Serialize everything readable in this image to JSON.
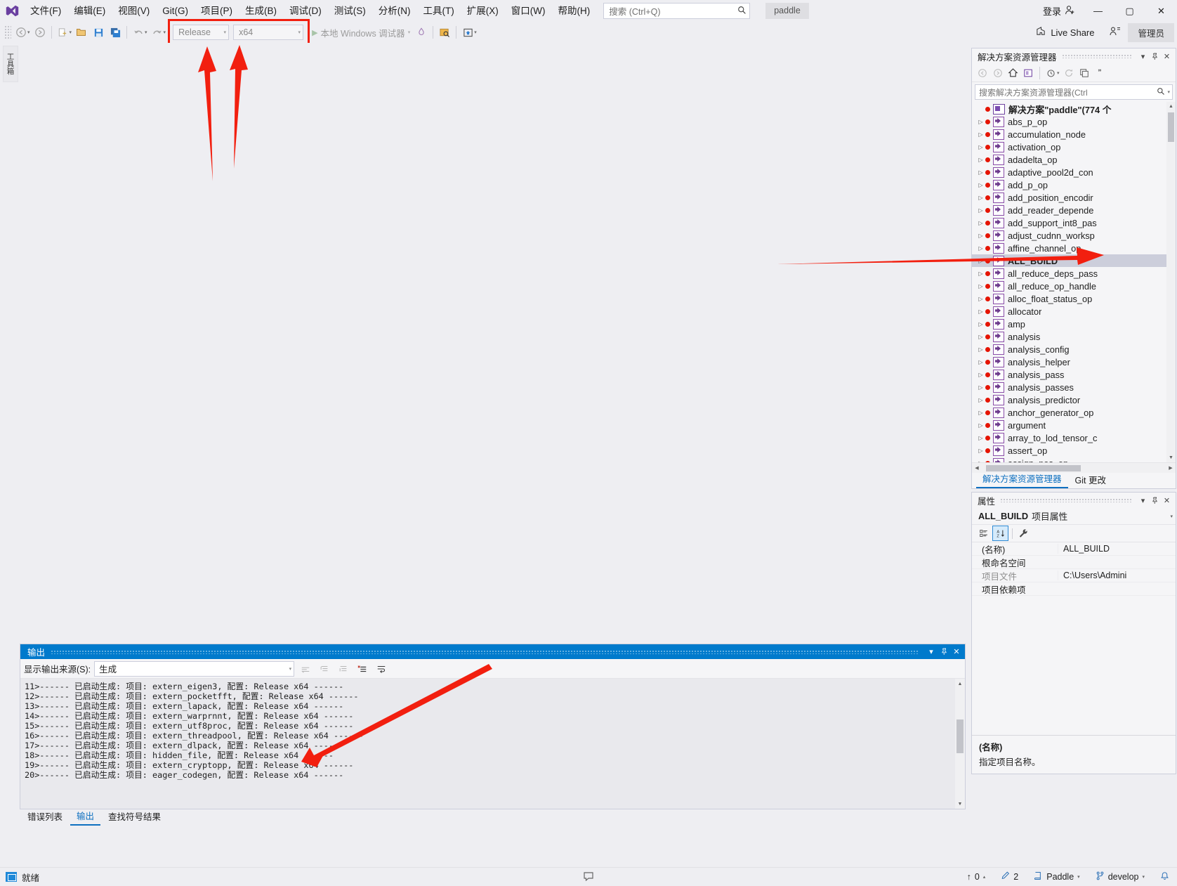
{
  "window": {
    "app_icon": "visual-studio-icon",
    "project_chip": "paddle",
    "signin_label": "登录",
    "minimize": "—",
    "maximize": "▢",
    "close": "✕",
    "live_share": "Live Share",
    "admin_badge": "管理员"
  },
  "menu": {
    "items": [
      "文件(F)",
      "编辑(E)",
      "视图(V)",
      "Git(G)",
      "项目(P)",
      "生成(B)",
      "调试(D)",
      "测试(S)",
      "分析(N)",
      "工具(T)",
      "扩展(X)",
      "窗口(W)",
      "帮助(H)"
    ]
  },
  "search": {
    "placeholder": "搜索 (Ctrl+Q)",
    "icon": "search-icon"
  },
  "toolbar": {
    "back_icon": "navigate-back-icon",
    "forward_icon": "navigate-forward-icon",
    "new_item_icon": "new-item-icon",
    "open_icon": "open-file-icon",
    "save_icon": "save-icon",
    "save_all_icon": "save-all-icon",
    "undo_icon": "undo-icon",
    "redo_icon": "redo-icon",
    "configuration": "Release",
    "platform": "x64",
    "run_label": "本地 Windows 调试器",
    "run_play_icon": "play-icon",
    "hot_reload_icon": "hot-reload-icon",
    "select_tool_icon": "select-element-icon",
    "live_visual_tree_icon": "live-visual-tree-icon"
  },
  "editor": {
    "vertical_tab_label": "工具箱"
  },
  "solution_explorer": {
    "title": "解决方案资源管理器",
    "dropdown_icon": "chevron-down-icon",
    "pin_icon": "pin-icon",
    "close_icon": "close-icon",
    "toolbar_icons": [
      "back-icon",
      "forward-icon",
      "home-icon",
      "solution-view-icon",
      "pending-changes-icon",
      "refresh-icon",
      "collapse-all-icon",
      "overflow-icon"
    ],
    "search_placeholder": "搜索解决方案资源管理器(Ctrl",
    "search_icon": "search-icon",
    "search_dropdown_icon": "chevron-down-icon",
    "root": "解决方案\"paddle\"(774 个",
    "items": [
      "abs_p_op",
      "accumulation_node",
      "activation_op",
      "adadelta_op",
      "adaptive_pool2d_con",
      "add_p_op",
      "add_position_encodir",
      "add_reader_depende",
      "add_support_int8_pas",
      "adjust_cudnn_worksp",
      "affine_channel_op",
      "ALL_BUILD",
      "all_reduce_deps_pass",
      "all_reduce_op_handle",
      "alloc_float_status_op",
      "allocator",
      "amp",
      "analysis",
      "analysis_config",
      "analysis_helper",
      "analysis_pass",
      "analysis_passes",
      "analysis_predictor",
      "anchor_generator_op",
      "argument",
      "array_to_lod_tensor_c",
      "assert_op",
      "assign_pos_op"
    ],
    "selected_item": "ALL_BUILD",
    "tabs": [
      {
        "label": "解决方案资源管理器",
        "active": true
      },
      {
        "label": "Git 更改",
        "active": false
      }
    ]
  },
  "properties": {
    "title": "属性",
    "dropdown_icon": "chevron-down-icon",
    "pin_icon": "pin-icon",
    "close_icon": "close-icon",
    "object_name": "ALL_BUILD",
    "object_kind": "项目属性",
    "object_dropdown_icon": "chevron-down-icon",
    "tool_icons": [
      "categorized-icon",
      "alphabetical-icon",
      "property-pages-icon"
    ],
    "rows": [
      {
        "key": "(名称)",
        "value": "ALL_BUILD",
        "dim": false
      },
      {
        "key": "根命名空间",
        "value": "",
        "dim": false
      },
      {
        "key": "项目文件",
        "value": "C:\\Users\\Admini",
        "dim": true
      },
      {
        "key": "项目依赖项",
        "value": "",
        "dim": false
      }
    ],
    "description_title": "(名称)",
    "description_text": "指定项目名称。"
  },
  "output": {
    "title": "输出",
    "dropdown_icon": "chevron-down-icon",
    "pin_icon": "pin-icon",
    "close_icon": "close-icon",
    "source_label": "显示输出来源(S):",
    "source_value": "生成",
    "source_dropdown_icon": "chevron-down-icon",
    "tool_icons": [
      "find-message-icon",
      "go-to-previous-icon",
      "go-to-next-icon",
      "clear-all-icon",
      "toggle-word-wrap-icon"
    ],
    "lines": [
      "11>------ 已启动生成: 项目: extern_eigen3, 配置: Release x64 ------",
      "12>------ 已启动生成: 项目: extern_pocketfft, 配置: Release x64 ------",
      "13>------ 已启动生成: 项目: extern_lapack, 配置: Release x64 ------",
      "14>------ 已启动生成: 项目: extern_warprnnt, 配置: Release x64 ------",
      "15>------ 已启动生成: 项目: extern_utf8proc, 配置: Release x64 ------",
      "16>------ 已启动生成: 项目: extern_threadpool, 配置: Release x64 ------",
      "17>------ 已启动生成: 项目: extern_dlpack, 配置: Release x64 ------",
      "18>------ 已启动生成: 项目: hidden_file, 配置: Release x64 ------",
      "19>------ 已启动生成: 项目: extern_cryptopp, 配置: Release x64 ------",
      "20>------ 已启动生成: 项目: eager_codegen, 配置: Release x64 ------"
    ],
    "tabs": [
      {
        "label": "错误列表",
        "active": false
      },
      {
        "label": "输出",
        "active": true
      },
      {
        "label": "查找符号结果",
        "active": false
      }
    ]
  },
  "statusbar": {
    "status": "就绪",
    "notify_icon": "notification-icon",
    "up_arrow": "↑",
    "pending_count": "0",
    "edit_count": "2",
    "edit_icon": "pencil-icon",
    "repo_name": "Paddle",
    "repo_icon": "repository-icon",
    "branch_name": "develop",
    "branch_icon": "branch-icon",
    "bell_icon": "bell-icon",
    "caret_icon": "chevron-up-icon"
  },
  "annotations": {
    "color": "#f21f0f",
    "marks": [
      "rect-around-configuration-combos",
      "arrow-to-configuration",
      "arrow-to-platform",
      "arrow-to-all-build",
      "arrow-to-output-log"
    ]
  }
}
